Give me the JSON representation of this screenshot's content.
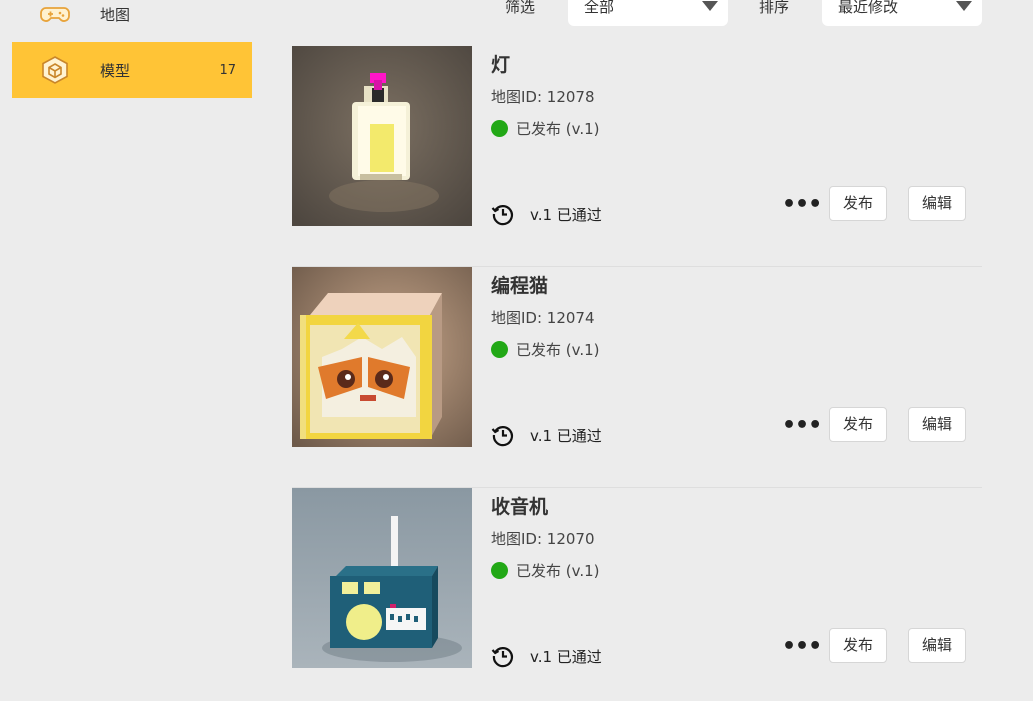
{
  "sidebar": {
    "items": [
      {
        "label": "地图",
        "icon": "gamepad-icon",
        "active": false
      },
      {
        "label": "模型",
        "icon": "cube-icon",
        "count": "17",
        "active": true
      }
    ]
  },
  "toolbar": {
    "filter_label": "筛选",
    "filter_value": "全部",
    "sort_label": "排序",
    "sort_value": "最近修改"
  },
  "cards": [
    {
      "title": "灯",
      "map_id": "地图ID: 12078",
      "status": "已发布 (v.1)",
      "review": "v.1 已通过",
      "publish_label": "发布",
      "edit_label": "编辑",
      "more": "•••",
      "thumb_icon": "lamp-thumbnail"
    },
    {
      "title": "编程猫",
      "map_id": "地图ID: 12074",
      "status": "已发布 (v.1)",
      "review": "v.1 已通过",
      "publish_label": "发布",
      "edit_label": "编辑",
      "more": "•••",
      "thumb_icon": "cat-box-thumbnail"
    },
    {
      "title": "收音机",
      "map_id": "地图ID: 12070",
      "status": "已发布 (v.1)",
      "review": "v.1 已通过",
      "publish_label": "发布",
      "edit_label": "编辑",
      "more": "•••",
      "thumb_icon": "radio-thumbnail"
    }
  ],
  "colors": {
    "background": "#ececec",
    "active_sidebar": "#ffc436",
    "status_green": "#22a816"
  }
}
